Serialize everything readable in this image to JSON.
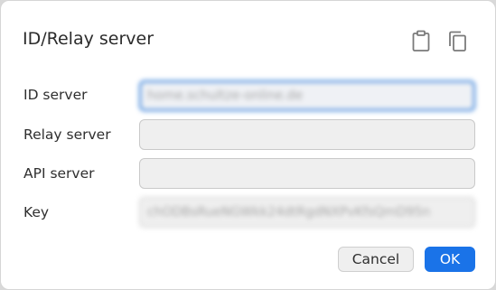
{
  "dialog": {
    "title": "ID/Relay server",
    "icons": [
      "clipboard-icon",
      "copy-icon"
    ]
  },
  "fields": {
    "id_server": {
      "label": "ID server",
      "value": "home.schultze-online.de"
    },
    "relay_server": {
      "label": "Relay server",
      "value": ""
    },
    "api_server": {
      "label": "API server",
      "value": ""
    },
    "key": {
      "label": "Key",
      "value": "chODBsRueNGWkk24dtRgdNXPvKfsQmD95n"
    }
  },
  "buttons": {
    "cancel": "Cancel",
    "ok": "OK"
  },
  "colors": {
    "accent": "#1a73e8",
    "focus_border": "#1a6fd6"
  }
}
